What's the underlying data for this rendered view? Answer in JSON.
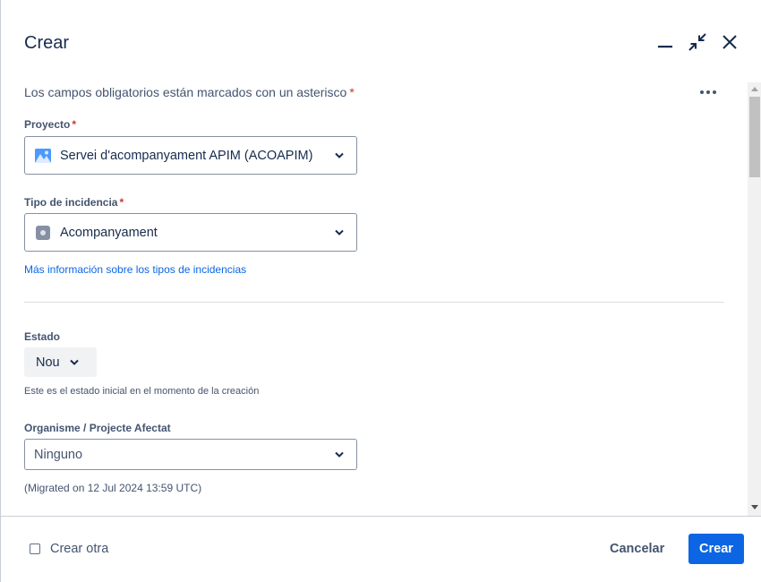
{
  "dialog": {
    "title": "Crear",
    "icons": {
      "minimize": "minimize-icon",
      "shrink": "collapse-arrows-icon",
      "close": "close-icon",
      "more": "more-horizontal-icon"
    }
  },
  "form": {
    "required_note": "Los campos obligatorios están marcados con un asterisco",
    "required_marker": "*",
    "project": {
      "label": "Proyecto",
      "value": "Servei d'acompanyament APIM (ACOAPIM)",
      "icon": "project-avatar-icon"
    },
    "issue_type": {
      "label": "Tipo de incidencia",
      "value": "Acompanyament",
      "icon": "issue-type-icon",
      "help_link": "Más información sobre los tipos de incidencias"
    },
    "status": {
      "label": "Estado",
      "value": "Nou",
      "help": "Este es el estado inicial en el momento de la creación"
    },
    "organisme": {
      "label": "Organisme / Projecte Afectat",
      "placeholder": "Ninguno",
      "help": "(Migrated on 12 Jul 2024 13:59 UTC)"
    }
  },
  "footer": {
    "create_another": "Crear otra",
    "create_another_checked": false,
    "cancel": "Cancelar",
    "submit": "Crear"
  },
  "colors": {
    "primary": "#0c66e4",
    "required": "#c9372c",
    "text": "#172b4d",
    "subtle_text": "#44546f"
  }
}
